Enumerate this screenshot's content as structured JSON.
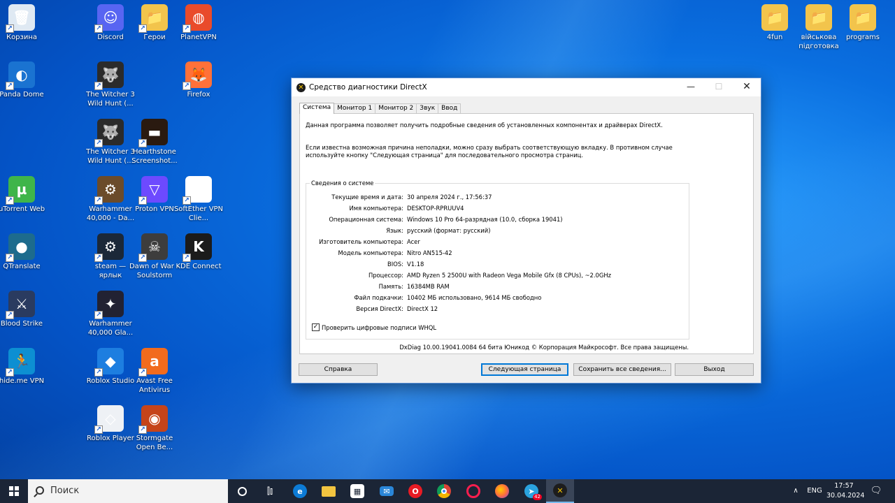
{
  "desktop": {
    "col1": [
      {
        "name": "recycle-bin-icon",
        "label": "Корзина",
        "glyph": "🗑"
      },
      {
        "name": "panda-dome-icon",
        "label": "Panda Dome",
        "glyph": "◐"
      },
      {
        "name": "utorrent-icon",
        "label": "uTorrent Web",
        "glyph": "µ"
      },
      {
        "name": "qtranslate-icon",
        "label": "QTranslate",
        "glyph": "●"
      },
      {
        "name": "blood-strike-icon",
        "label": "Blood Strike",
        "glyph": "⚔"
      },
      {
        "name": "hideme-vpn-icon",
        "label": "hide.me VPN",
        "glyph": "🏃"
      }
    ],
    "col2": [
      {
        "name": "discord-icon",
        "label": "Discord",
        "glyph": "☺"
      },
      {
        "name": "witcher-icon",
        "label": "The Witcher 3 Wild Hunt (...",
        "glyph": "🐺"
      },
      {
        "name": "witcher-icon-2",
        "label": "The Witcher 3 Wild Hunt (...",
        "glyph": "🐺"
      },
      {
        "name": "warhammer-icon",
        "label": "Warhammer 40,000 - Da...",
        "glyph": "⚙"
      },
      {
        "name": "steam-icon",
        "label": "steam — ярлык",
        "glyph": "⚙"
      },
      {
        "name": "warhammer-gladius-icon",
        "label": "Warhammer 40,000 Gla...",
        "glyph": "✦"
      },
      {
        "name": "roblox-studio-icon",
        "label": "Roblox Studio",
        "glyph": "◆"
      },
      {
        "name": "roblox-player-icon",
        "label": "Roblox Player",
        "glyph": "◇"
      }
    ],
    "col2b": [
      {
        "name": "heroes-folder-icon",
        "label": "Герои",
        "glyph": "📁"
      },
      {
        "name": "hearthstone-screenshot-icon",
        "label": "Hearthstone Screenshot...",
        "glyph": "▬"
      },
      {
        "name": "proton-vpn-icon",
        "label": "Proton VPN",
        "glyph": "▽"
      },
      {
        "name": "dawn-of-war-icon",
        "label": "Dawn of War – Soulstorm",
        "glyph": "☠"
      },
      {
        "name": "avast-icon",
        "label": "Avast Free Antivirus",
        "glyph": "a"
      },
      {
        "name": "stormgate-icon",
        "label": "Stormgate Open Be...",
        "glyph": "◉"
      }
    ],
    "col3": [
      {
        "name": "planetvpn-icon",
        "label": "PlanetVPN",
        "glyph": "◍"
      },
      {
        "name": "firefox-icon",
        "label": "Firefox",
        "glyph": "🦊"
      },
      {
        "name": "softether-icon",
        "label": "SoftEther VPN Clie...",
        "glyph": "●"
      },
      {
        "name": "kde-connect-icon",
        "label": "KDE Connect",
        "glyph": "K"
      }
    ],
    "right": [
      {
        "name": "folder-4fun-icon",
        "label": "4fun",
        "glyph": "📁"
      },
      {
        "name": "folder-military-icon",
        "label": "військова підготовка",
        "glyph": "📁"
      },
      {
        "name": "folder-programs-icon",
        "label": "programs",
        "glyph": "📁"
      }
    ]
  },
  "window": {
    "title": "Средство диагностики DirectX",
    "min": "—",
    "max": "☐",
    "close": "✕",
    "tabs": [
      "Система",
      "Монитор 1",
      "Монитор 2",
      "Звук",
      "Ввод"
    ],
    "intro1": "Данная программа позволяет получить подробные сведения об установленных компонентах и драйверах DirectX.",
    "intro2": "Если известна возможная причина неполадки, можно сразу выбрать соответствующую вкладку. В противном случае используйте кнопку \"Следующая страница\" для последовательного просмотра страниц.",
    "group_title": "Сведения о системе",
    "rows": [
      {
        "k": "Текущие время и дата:",
        "v": "30 апреля 2024 г., 17:56:37"
      },
      {
        "k": "Имя компьютера:",
        "v": "DESKTOP-RPRUUV4"
      },
      {
        "k": "Операционная система:",
        "v": "Windows 10 Pro 64-разрядная (10.0, сборка 19041)"
      },
      {
        "k": "Язык:",
        "v": "русский (формат: русский)"
      },
      {
        "k": "Изготовитель компьютера:",
        "v": "Acer"
      },
      {
        "k": "Модель компьютера:",
        "v": "Nitro AN515-42"
      },
      {
        "k": "BIOS:",
        "v": "V1.18"
      },
      {
        "k": "Процессор:",
        "v": "AMD Ryzen 5 2500U with Radeon Vega Mobile Gfx   (8 CPUs), ~2.0GHz"
      },
      {
        "k": "Память:",
        "v": "16384MB RAM"
      },
      {
        "k": "Файл подкачки:",
        "v": "10402 МБ использовано, 9614 МБ свободно"
      },
      {
        "k": "Версия DirectX:",
        "v": "DirectX 12"
      }
    ],
    "whql_label": "Проверить цифровые подписи WHQL",
    "whql_checked": "✓",
    "copyright": "DxDiag 10.00.19041.0084 64 бита Юникод © Корпорация Майкрософт. Все права защищены.",
    "buttons": {
      "help": "Справка",
      "next": "Следующая страница",
      "save": "Сохранить все сведения...",
      "exit": "Выход"
    }
  },
  "taskbar": {
    "search_placeholder": "Поиск",
    "lang": "ENG",
    "time": "17:57",
    "date": "30.04.2024",
    "telegram_badge": "42",
    "chevron": "∧",
    "notification": "🗨"
  }
}
